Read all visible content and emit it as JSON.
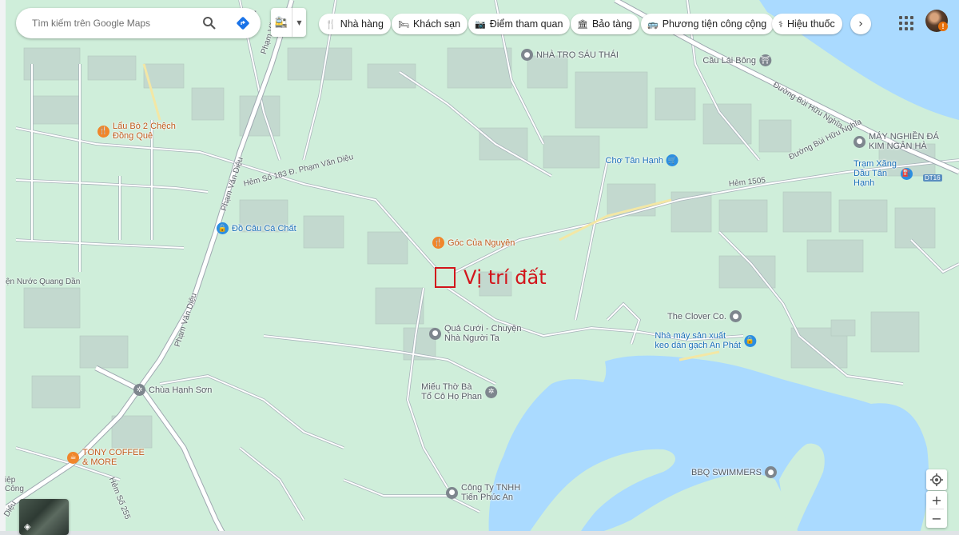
{
  "search": {
    "placeholder": "Tìm kiếm trên Google Maps"
  },
  "icons": {
    "search": "search-icon",
    "directions": "directions-icon",
    "layers": "layers-icon",
    "apps": "apps-grid-icon",
    "locate": "my-location-icon"
  },
  "category_chips": [
    {
      "label": "Nhà hàng",
      "icon": "restaurant-icon",
      "glyph": "🍴"
    },
    {
      "label": "Khách sạn",
      "icon": "hotel-icon",
      "glyph": "🛏"
    },
    {
      "label": "Điểm tham quan",
      "icon": "camera-icon",
      "glyph": "📷"
    },
    {
      "label": "Bảo tàng",
      "icon": "museum-icon",
      "glyph": "🏛"
    },
    {
      "label": "Phương tiện công cộng",
      "icon": "transit-icon",
      "glyph": "🚌"
    },
    {
      "label": "Hiệu thuốc",
      "icon": "pharmacy-icon",
      "glyph": "⚕"
    }
  ],
  "zoom": {
    "in": "+",
    "out": "−"
  },
  "user": {
    "badge": "!"
  },
  "colors": {
    "water": "#aadaff",
    "land": "#cfeeda",
    "road": "#ffffff",
    "road_outline": "#a4aeb6",
    "building": "#c4d8ce",
    "marker": "#d2151b",
    "poi_gray": "#7e868e",
    "poi_orange": "#f0862b",
    "poi_blue": "#2c8ee0"
  },
  "marker": {
    "label": "Vị trí đất"
  },
  "places": [
    {
      "name": "NHÀ TRỌ SÁU THÁI",
      "type": "gray",
      "glyph": "●"
    },
    {
      "name": "Cầu Lái Bông",
      "type": "gray",
      "glyph": "⛩"
    },
    {
      "name": "Lẩu Bò 2 Chệch\nĐồng Quê",
      "type": "orange",
      "glyph": "🍴"
    },
    {
      "name": "Chợ Tân Hạnh",
      "type": "blue",
      "glyph": "🛒"
    },
    {
      "name": "MÁY NGHIỀN ĐÁ\nKIM NGÂN HÀ",
      "type": "gray",
      "glyph": "●"
    },
    {
      "name": "Trạm Xăng\nDầu Tân Hạnh",
      "type": "blue",
      "glyph": "⛽"
    },
    {
      "name": "Đồ Câu Cá Chất",
      "type": "blue",
      "glyph": "🔒"
    },
    {
      "name": "Góc Của Nguyên",
      "type": "orange",
      "glyph": "🍴"
    },
    {
      "name": "The Clover Co.",
      "type": "gray",
      "glyph": "●"
    },
    {
      "name": "Nhà máy sản xuất\nkeo dán gạch An Phát",
      "type": "blue",
      "glyph": "🔒"
    },
    {
      "name": "Quả Cưới - Chuyện\nNhà Người Ta",
      "type": "gray",
      "glyph": "●"
    },
    {
      "name": "Miếu Thờ Bà\nTổ Cô Họ Phan",
      "type": "gray",
      "glyph": "✲"
    },
    {
      "name": "Chùa Hạnh Sơn",
      "type": "gray",
      "glyph": "✲"
    },
    {
      "name": "TONY COFFEE\n& MORE",
      "type": "orange",
      "glyph": "☕"
    },
    {
      "name": "BBQ SWIMMERS",
      "type": "gray",
      "glyph": "●"
    },
    {
      "name": "Công Ty TNHH\nTiến Phúc An",
      "type": "gray",
      "glyph": "●"
    }
  ],
  "roads": [
    {
      "name": "Hẻm Số 183 Đ. Phạm Văn Diệu"
    },
    {
      "name": "Phạm Văn Diệu"
    },
    {
      "name": "Phạm Văn Diệu"
    },
    {
      "name": "Phạm Văn"
    },
    {
      "name": "Diệu"
    },
    {
      "name": "Đường Bùi Hữu Nghĩa"
    },
    {
      "name": "Đường Bùi Hữu Nghĩa"
    },
    {
      "name": "Hẻm 1505"
    },
    {
      "name": "Hẻm Số 255"
    },
    {
      "name": "ện Nước Quang Dần"
    },
    {
      "name": "DT16"
    },
    {
      "name": "iệp\nCông"
    },
    {
      "name": "Diệu"
    }
  ]
}
